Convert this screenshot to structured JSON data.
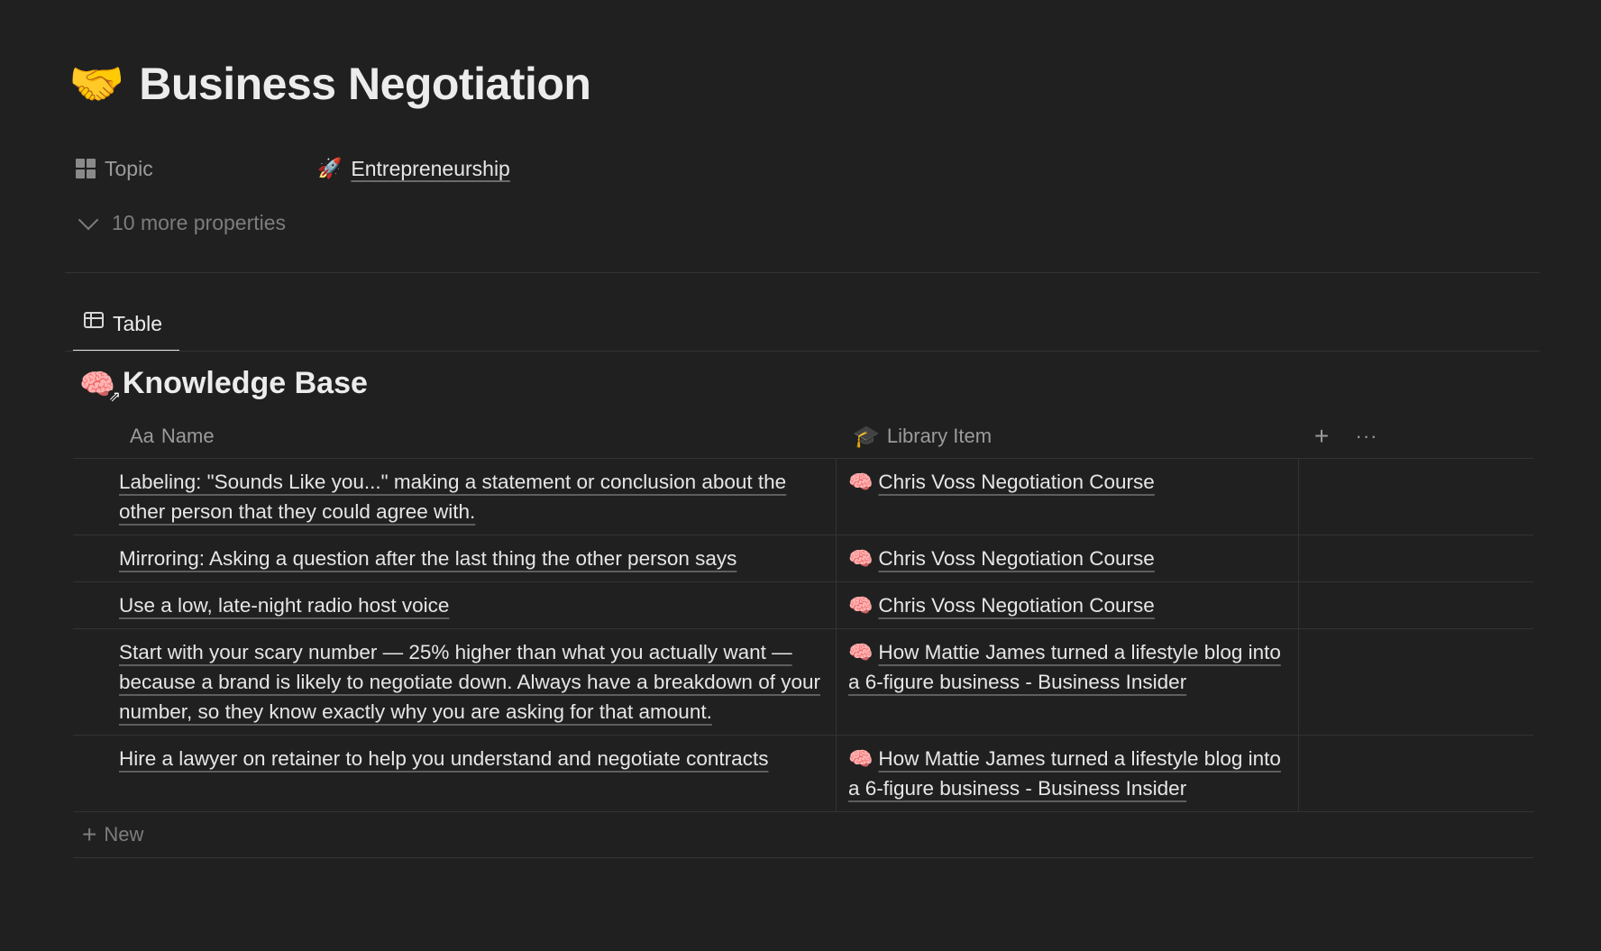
{
  "page": {
    "icon": "🤝",
    "title": "Business Negotiation"
  },
  "properties": {
    "topic_label": "Topic",
    "topic_icon": "grid-icon",
    "topic_value_icon": "🚀",
    "topic_value": "Entrepreneurship",
    "more_label": "10 more properties"
  },
  "view": {
    "tab_label": "Table",
    "tab_icon": "table-icon"
  },
  "database": {
    "icon": "🧠",
    "title": "Knowledge Base",
    "columns": {
      "name_prefix": "Aa",
      "name": "Name",
      "library_icon": "🎓",
      "library": "Library Item",
      "add": "+",
      "more": "···"
    },
    "rows": [
      {
        "name": "Labeling: \"Sounds Like you...\" making a statement or conclusion about the other person that they could agree with.",
        "library_icon": "🧠",
        "library": "Chris Voss Negotiation Course"
      },
      {
        "name": "Mirroring: Asking a question after the last thing the other person says",
        "library_icon": "🧠",
        "library": "Chris Voss Negotiation Course"
      },
      {
        "name": "Use a low, late-night radio host voice",
        "library_icon": "🧠",
        "library": "Chris Voss Negotiation Course"
      },
      {
        "name": "Start with your scary number — 25% higher than what you actually want — because a brand is likely to negotiate down. Always have a breakdown of your number, so they know exactly why you are asking for that amount.",
        "library_icon": "🧠",
        "library": "How Mattie James turned a lifestyle blog into a 6-figure business - Business Insider"
      },
      {
        "name": "Hire a lawyer on retainer to help you understand and negotiate contracts",
        "library_icon": "🧠",
        "library": "How Mattie James turned a lifestyle blog into a 6-figure business - Business Insider"
      }
    ],
    "new_label": "New"
  }
}
